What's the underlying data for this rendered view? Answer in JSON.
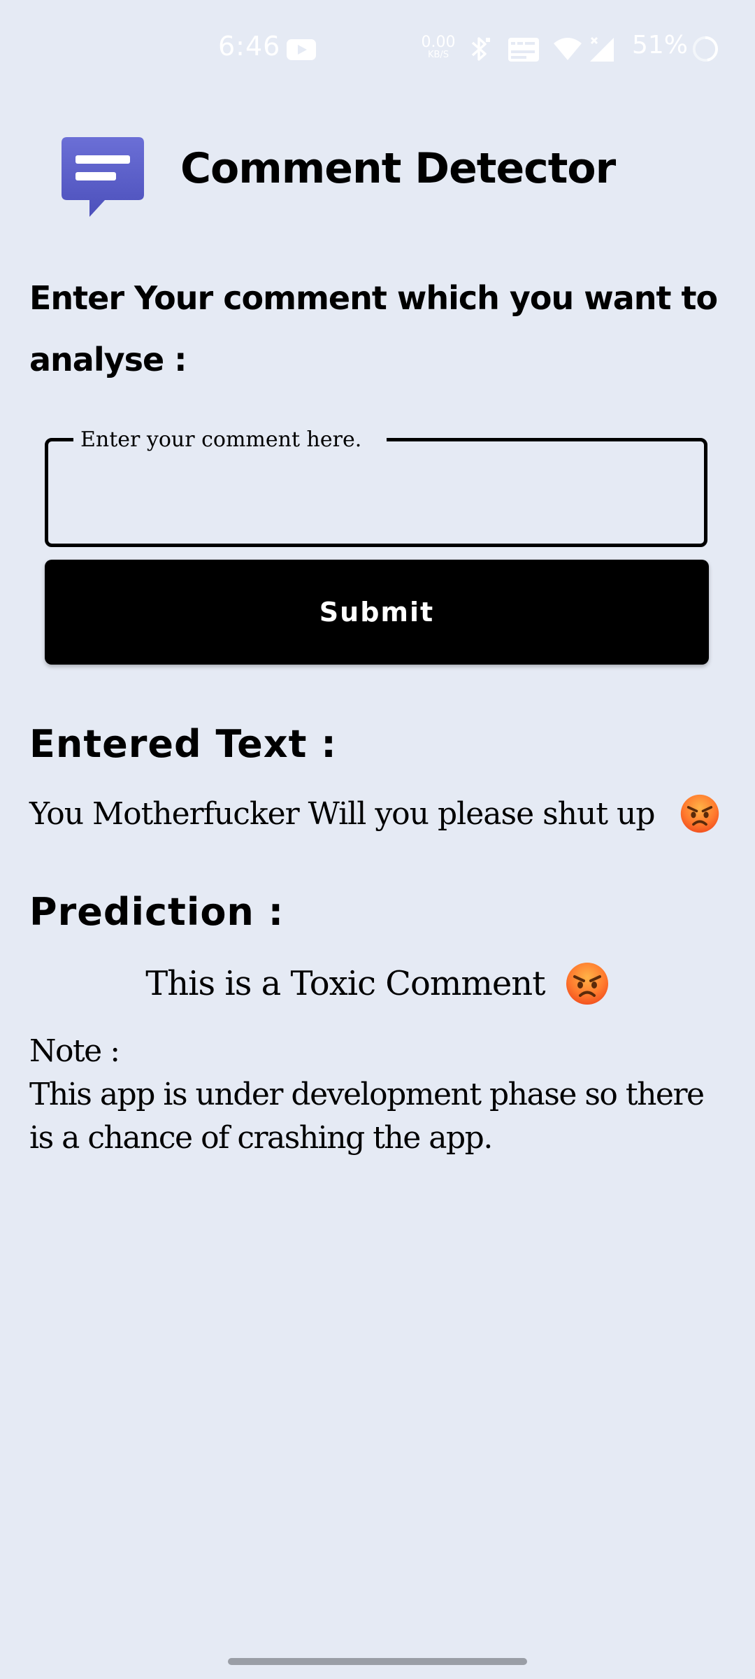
{
  "status_bar": {
    "time": "6:46",
    "speed_value": "0.00",
    "speed_unit": "KB/S",
    "battery": "51%",
    "icons": [
      "youtube-icon",
      "bluetooth-icon",
      "vowifi-icon",
      "wifi-icon",
      "signal-icon",
      "battery-icon"
    ]
  },
  "header": {
    "title": "Comment Detector",
    "icon": "chat-message-icon",
    "icon_color": "#5b5fc7"
  },
  "prompt": "Enter Your comment which you want to analyse :",
  "input": {
    "label": "Enter your comment here.",
    "value": ""
  },
  "submit_label": "Submit",
  "entered": {
    "heading": "Entered Text :",
    "text": "You Motherfucker Will you please shut up"
  },
  "prediction": {
    "heading": "Prediction :",
    "result": "This is a Toxic Comment",
    "emoji": "angry-face-icon"
  },
  "note": {
    "label": "Note :",
    "text": "This app is under development phase so there is a chance of crashing the app."
  },
  "colors": {
    "background": "#e5eaf4",
    "button": "#000000",
    "accent": "#5b5fc7"
  }
}
